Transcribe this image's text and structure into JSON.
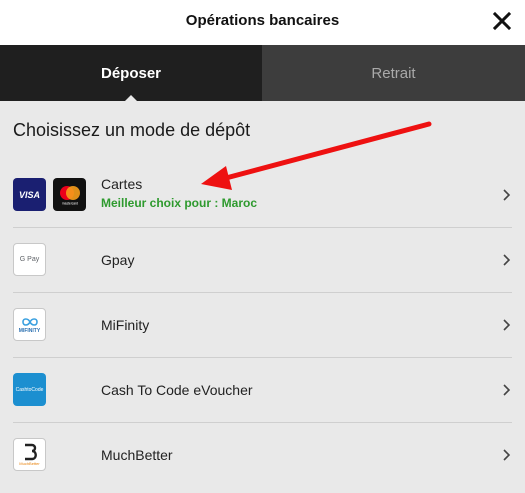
{
  "header": {
    "title": "Opérations bancaires"
  },
  "tabs": [
    {
      "label": "Déposer",
      "active": true
    },
    {
      "label": "Retrait",
      "active": false
    }
  ],
  "heading": "Choisissez un mode de dépôt",
  "methods": [
    {
      "label": "Cartes",
      "sub": "Meilleur choix pour : Maroc",
      "logos": [
        "visa-icon",
        "mastercard-icon"
      ]
    },
    {
      "label": "Gpay",
      "logo_text": "G Pay",
      "logo": "gpay-icon"
    },
    {
      "label": "MiFinity",
      "logo_text": "MIFINITY",
      "logo": "mifinity-icon"
    },
    {
      "label": "Cash To Code eVoucher",
      "logo_text": "CashtoCode",
      "logo": "cashtocode-icon"
    },
    {
      "label": "MuchBetter",
      "logo_text": "MuchBetter",
      "logo": "muchbetter-icon"
    }
  ],
  "logo_texts": {
    "visa": "VISA",
    "mastercard": "mastercard"
  },
  "colors": {
    "active_tab": "#1f1f1f",
    "inactive_tab": "#3d3d3d",
    "highlight": "#2e9a2e",
    "annotation_arrow": "#ee1111"
  }
}
